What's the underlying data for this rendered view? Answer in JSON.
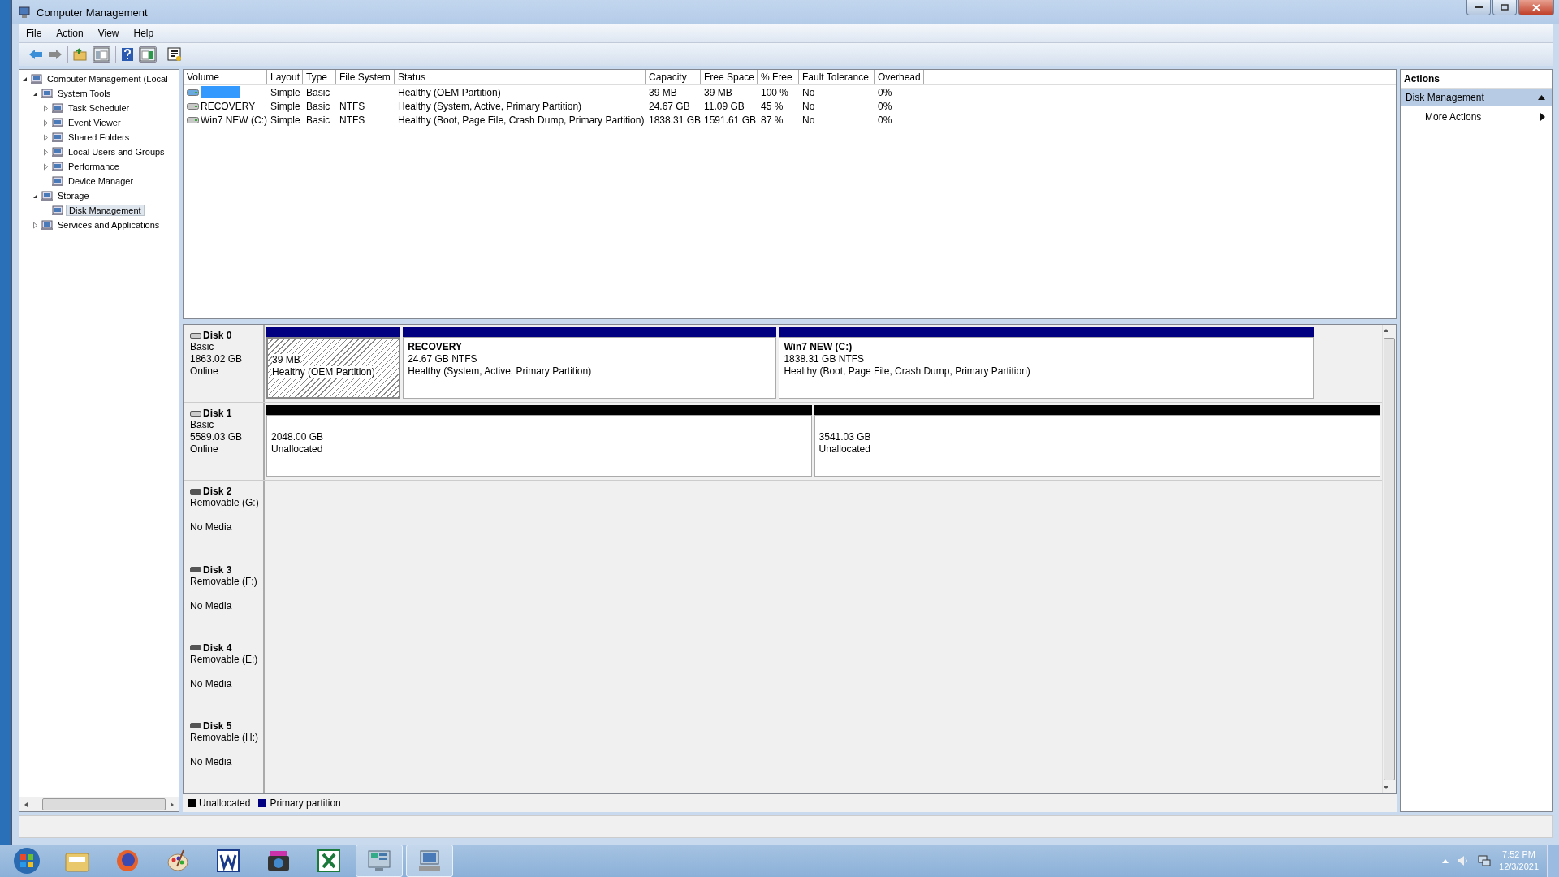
{
  "window": {
    "title": "Computer Management"
  },
  "menu": [
    "File",
    "Action",
    "View",
    "Help"
  ],
  "tree": [
    {
      "label": "Computer Management (Local",
      "selected": false,
      "expanded": true,
      "children": [
        {
          "label": "System Tools",
          "selected": false,
          "expanded": true,
          "children": [
            {
              "label": "Task Scheduler",
              "selected": false,
              "expanded": false
            },
            {
              "label": "Event Viewer",
              "selected": false,
              "expanded": false
            },
            {
              "label": "Shared Folders",
              "selected": false,
              "expanded": false
            },
            {
              "label": "Local Users and Groups",
              "selected": false,
              "expanded": false
            },
            {
              "label": "Performance",
              "selected": false,
              "expanded": false
            },
            {
              "label": "Device Manager",
              "selected": false
            }
          ]
        },
        {
          "label": "Storage",
          "selected": false,
          "expanded": true,
          "children": [
            {
              "label": "Disk Management",
              "selected": true
            }
          ]
        },
        {
          "label": "Services and Applications",
          "selected": false,
          "expanded": false
        }
      ]
    }
  ],
  "volumes": {
    "columns": [
      "Volume",
      "Layout",
      "Type",
      "File System",
      "Status",
      "Capacity",
      "Free Space",
      "% Free",
      "Fault Tolerance",
      "Overhead"
    ],
    "rows": [
      {
        "selected": true,
        "cells": [
          "",
          "Simple",
          "Basic",
          "",
          "Healthy (OEM Partition)",
          "39 MB",
          "39 MB",
          "100 %",
          "No",
          "0%"
        ]
      },
      {
        "selected": false,
        "cells": [
          "RECOVERY",
          "Simple",
          "Basic",
          "NTFS",
          "Healthy (System, Active, Primary Partition)",
          "24.67 GB",
          "11.09 GB",
          "45 %",
          "No",
          "0%"
        ]
      },
      {
        "selected": false,
        "cells": [
          "Win7 NEW (C:)",
          "Simple",
          "Basic",
          "NTFS",
          "Healthy (Boot, Page File, Crash Dump, Primary Partition)",
          "1838.31 GB",
          "1591.61 GB",
          "87 %",
          "No",
          "0%"
        ]
      }
    ]
  },
  "disks": [
    {
      "name": "Disk 0",
      "kind": "basic",
      "type": "Basic",
      "size": "1863.02 GB",
      "status": "Online",
      "partitions": [
        {
          "kind": "primary",
          "selected": true,
          "size": "39 MB",
          "status": "Healthy (OEM Partition)"
        },
        {
          "kind": "primary",
          "selected": false,
          "title": "RECOVERY",
          "size": "24.67 GB NTFS",
          "status": "Healthy (System, Active, Primary Partition)"
        },
        {
          "kind": "primary",
          "selected": false,
          "title": "Win7 NEW  (C:)",
          "size": "1838.31 GB NTFS",
          "status": "Healthy (Boot, Page File, Crash Dump, Primary Partition)"
        }
      ]
    },
    {
      "name": "Disk 1",
      "kind": "basic",
      "type": "Basic",
      "size": "5589.03 GB",
      "status": "Online",
      "partitions": [
        {
          "kind": "unallocated",
          "selected": false,
          "size": "2048.00 GB",
          "status": "Unallocated"
        },
        {
          "kind": "unallocated",
          "selected": false,
          "size": "3541.03 GB",
          "status": "Unallocated"
        }
      ]
    },
    {
      "name": "Disk 2",
      "kind": "removable",
      "type": "Removable (G:)",
      "status": "No Media"
    },
    {
      "name": "Disk 3",
      "kind": "removable",
      "type": "Removable (F:)",
      "status": "No Media"
    },
    {
      "name": "Disk 4",
      "kind": "removable",
      "type": "Removable (E:)",
      "status": "No Media"
    },
    {
      "name": "Disk 5",
      "kind": "removable",
      "type": "Removable (H:)",
      "status": "No Media"
    }
  ],
  "legend": [
    {
      "label": "Unallocated",
      "color": "#000000"
    },
    {
      "label": "Primary partition",
      "color": "#000080"
    }
  ],
  "actions": {
    "title": "Actions",
    "section": "Disk Management",
    "items": [
      "More Actions"
    ]
  },
  "taskbar": {
    "apps": [
      {
        "selected": false
      },
      {
        "selected": false
      },
      {
        "selected": false
      },
      {
        "selected": false
      },
      {
        "selected": false
      },
      {
        "selected": false
      },
      {
        "selected": false
      },
      {
        "selected": true
      },
      {
        "selected": true
      }
    ],
    "time": "7:52 PM",
    "date": "12/3/2021"
  }
}
